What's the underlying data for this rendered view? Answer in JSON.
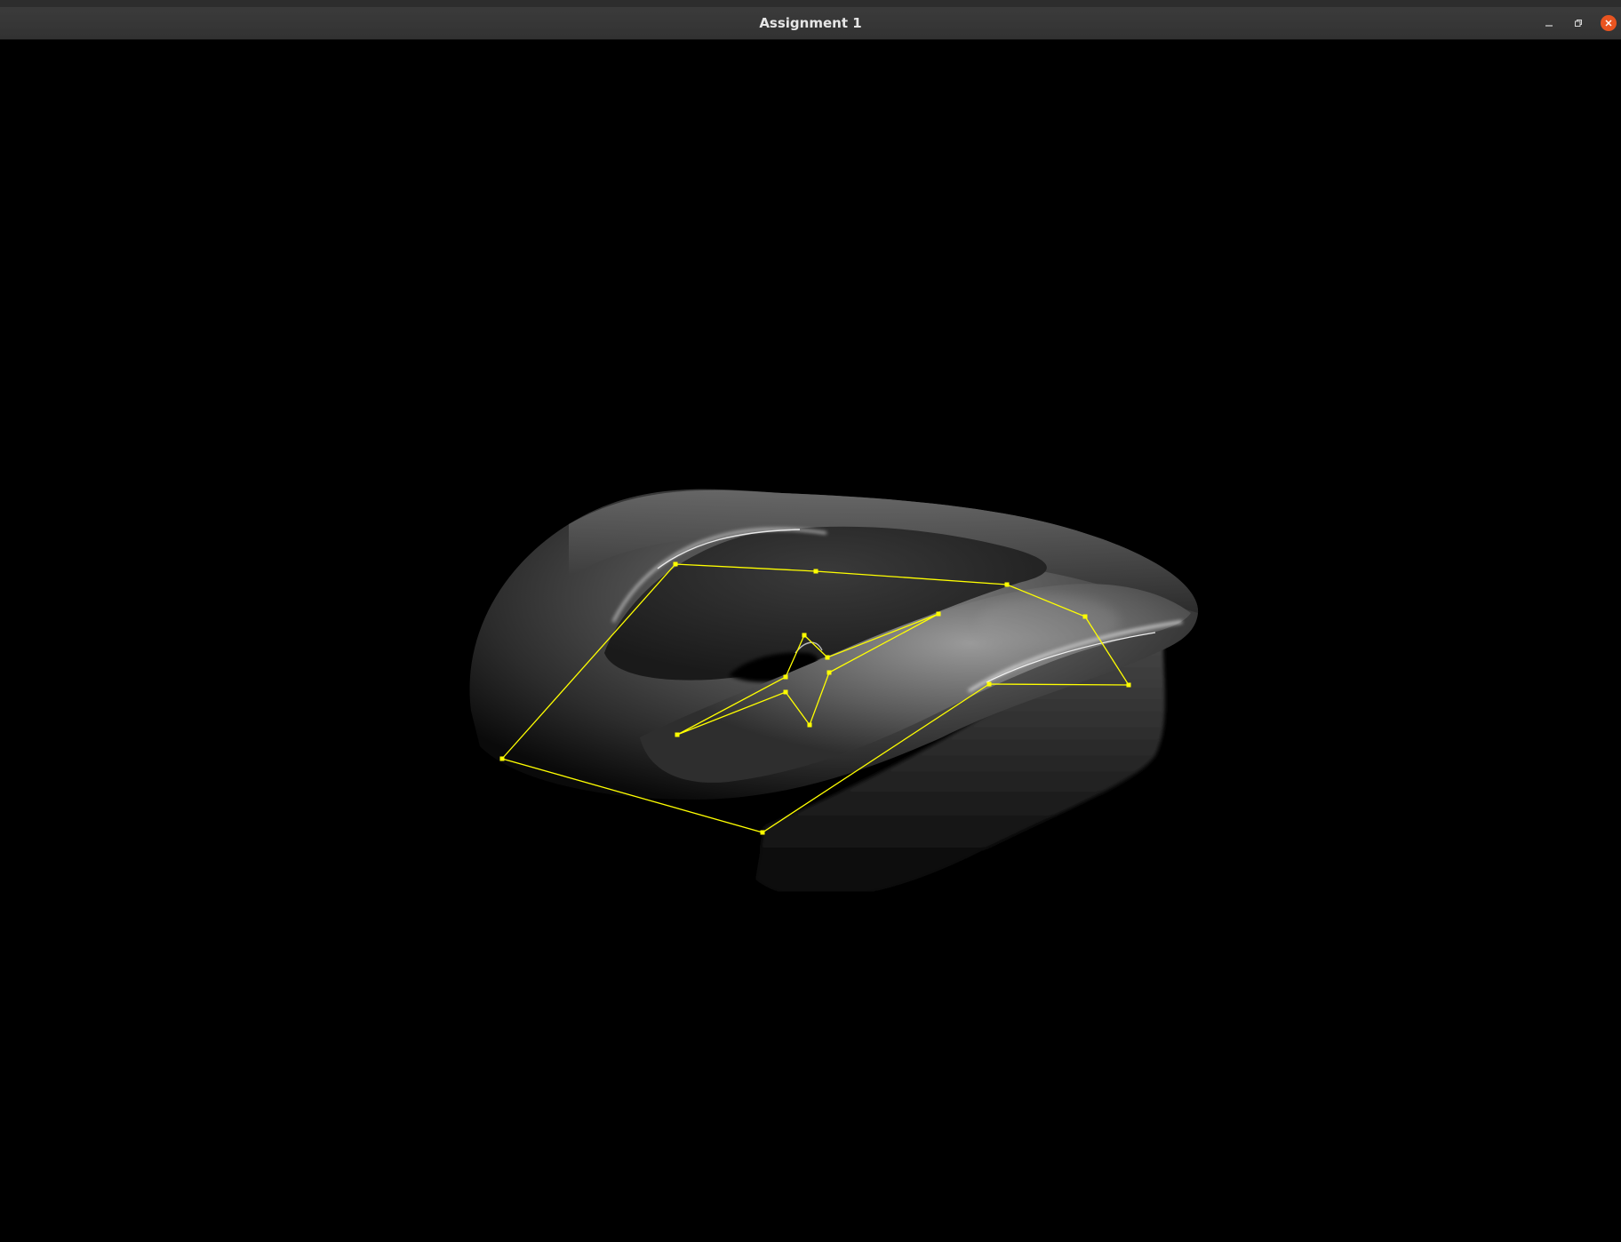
{
  "window": {
    "title": "Assignment 1"
  },
  "icons": {
    "minimize": "minimize-icon",
    "maximize": "restore-icon",
    "close": "close-icon"
  },
  "colors": {
    "titlebar_bg": "#363636",
    "title_text": "#e6e6e6",
    "close_button": "#e95420",
    "viewport_bg": "#000000",
    "surface_shade": "#5a5a5a",
    "control_polygon": "#ffff00"
  },
  "scene": {
    "surface": "shaded-3d-surface",
    "overlay": "control-polygon-wireframe"
  }
}
